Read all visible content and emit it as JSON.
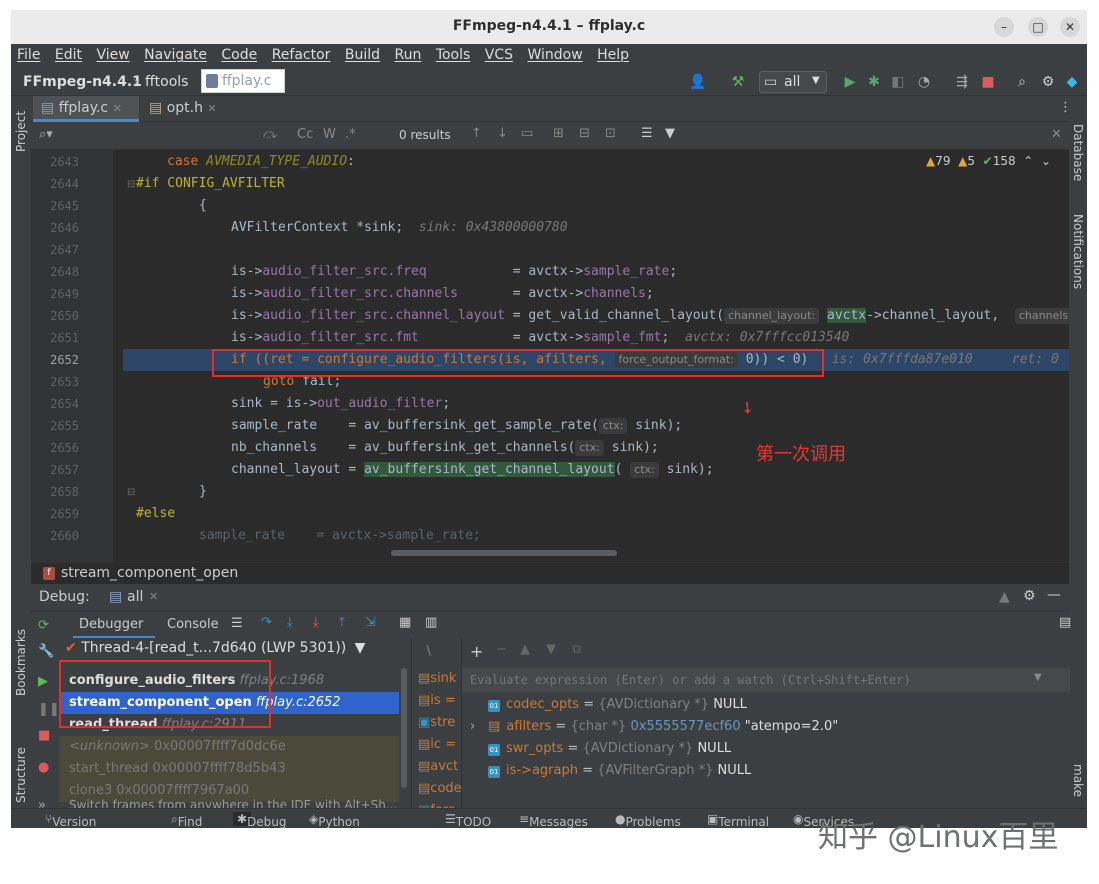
{
  "window": {
    "title": "FFmpeg-n4.4.1 – ffplay.c"
  },
  "menu": [
    "File",
    "Edit",
    "View",
    "Navigate",
    "Code",
    "Refactor",
    "Build",
    "Run",
    "Tools",
    "VCS",
    "Window",
    "Help"
  ],
  "nav": {
    "project": "FFmpeg-n4.4.1",
    "folder": "fftools",
    "file": "ffplay.c",
    "run_config": "all"
  },
  "editor_tabs": [
    "ffplay.c",
    "opt.h"
  ],
  "search": {
    "results": "0 results",
    "cc": "Cc",
    "w": "W",
    "star": ".*"
  },
  "inspections": {
    "warnings": "79",
    "weak_warnings": "5",
    "ok": "158"
  },
  "side": {
    "project": "Project",
    "bookmarks": "Bookmarks",
    "structure": "Structure",
    "database": "Database",
    "notifications": "Notifications",
    "make": "make"
  },
  "code": {
    "lines": [
      "2643",
      "2644",
      "2645",
      "2646",
      "2647",
      "2648",
      "2649",
      "2650",
      "2651",
      "2652",
      "2653",
      "2654",
      "2655",
      "2656",
      "2657",
      "2658",
      "2659",
      "2660"
    ],
    "l2643_kw": "case",
    "l2643_macro": "AVMEDIA_TYPE_AUDIO",
    "l2643_rest": ":",
    "l2644": "#if CONFIG_AVFILTER",
    "l2645": "{",
    "l2646_code": "AVFilterContext *sink;",
    "l2646_inl": "sink: 0x43800000780",
    "l2648_a": "is->",
    "l2648_f": "audio_filter_src.freq",
    "l2648_b": "= avctx->",
    "l2648_g": "sample_rate",
    "l2648_c": ";",
    "l2649_f": "audio_filter_src.channels",
    "l2649_g": "channels",
    "l2650_f": "audio_filter_src.channel_layout",
    "l2650_b": "= get_valid_channel_layout(",
    "l2650_hint": "channel_layout:",
    "l2650_hl": "avctx",
    "l2650_c": "->channel_layout,",
    "l2650_hint2": "channels",
    "l2651_f": "audio_filter_src.fmt",
    "l2651_g": "sample_fmt",
    "l2651_inl": "avctx: 0x7fffcc013540",
    "l2652_a": "if ((ret = configure_audio_filters(is, afilters,",
    "l2652_hint": "force_output_format:",
    "l2652_b": "0)) < 0)",
    "l2652_inl1": "is: 0x7fffda87e010",
    "l2652_inl2": "ret: 0",
    "l2653_kw": "goto",
    "l2653_rest": "fail;",
    "l2654_a": "sink = is->",
    "l2654_f": "out_audio_filter",
    "l2655_a": "sample_rate    = av_buffersink_get_sample_rate(",
    "l2655_hint": "ctx:",
    "l2655_b": "sink);",
    "l2656_a": "nb_channels    = av_buffersink_get_channels(",
    "l2657_a": "channel_layout = ",
    "l2657_hl": "av_buffersink_get_channel_layout",
    "l2657_b": "(",
    "l2658": "}",
    "l2659": "#else",
    "l2660": "sample_rate    = avctx->sample_rate;"
  },
  "annotation": "第一次调用",
  "editor_crumb": "stream_component_open",
  "debug": {
    "label": "Debug:",
    "config": "all",
    "tabs": {
      "debugger": "Debugger",
      "console": "Console"
    },
    "thread": "Thread-4-[read_t...7d640 (LWP 5301))",
    "frames": [
      {
        "fn": "configure_audio_filters",
        "loc": "ffplay.c:1968"
      },
      {
        "fn": "stream_component_open",
        "loc": "ffplay.c:2652"
      },
      {
        "fn": "read_thread",
        "loc": "ffplay.c:2911"
      },
      {
        "fn": "<unknown>",
        "loc": "0x00007ffff7d0dc6e"
      },
      {
        "fn": "start_thread",
        "loc": "0x00007ffff78d5b43"
      },
      {
        "fn": "clone3",
        "loc": "0x00007ffff7967a00"
      }
    ],
    "frames_hint": "Switch frames from anywhere in the IDE with Alt+Sh...",
    "narrow_vars": [
      "sink",
      "is =",
      "stre",
      "ic =",
      "avct",
      "code",
      "forc"
    ],
    "eval_placeholder": "Evaluate expression (Enter) or add a watch (Ctrl+Shift+Enter)",
    "watches": [
      {
        "name": "codec_opts",
        "type": "{AVDictionary *}",
        "value": "NULL"
      },
      {
        "name": "afilters",
        "type": "{char *}",
        "value": "0x5555577ecf60",
        "extra": "\"atempo=2.0\""
      },
      {
        "name": "swr_opts",
        "type": "{AVDictionary *}",
        "value": "NULL"
      },
      {
        "name": "is->agraph",
        "type": "{AVFilterGraph *}",
        "value": "NULL"
      }
    ]
  },
  "statusbar": [
    "Version Control",
    "Find",
    "Debug",
    "Python Packages",
    "TODO",
    "Messages",
    "Problems",
    "Terminal",
    "Services"
  ],
  "watermark": "知乎 @Linux百里",
  "colors": {
    "accent": "#2f65ca",
    "highlight_box": "#e0302d",
    "background": "#2b2b2b"
  }
}
